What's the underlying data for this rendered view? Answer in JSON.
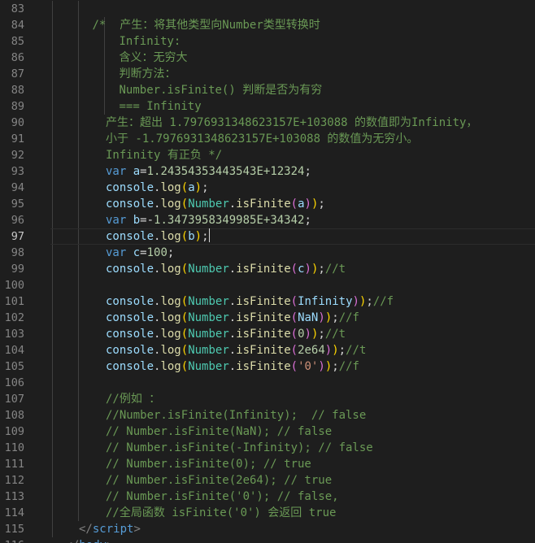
{
  "editor": {
    "current_line": "97",
    "lines": [
      {
        "n": "83",
        "indent": 0,
        "tokens": []
      },
      {
        "n": "84",
        "indent": 3,
        "tokens": [
          {
            "t": "/*  产生：将其他类型向Number类型转换时",
            "c": "comment"
          }
        ]
      },
      {
        "n": "85",
        "indent": 5,
        "tokens": [
          {
            "t": "Infinity:",
            "c": "comment"
          }
        ]
      },
      {
        "n": "86",
        "indent": 5,
        "tokens": [
          {
            "t": "含义：无穷大",
            "c": "comment"
          }
        ]
      },
      {
        "n": "87",
        "indent": 5,
        "tokens": [
          {
            "t": "判断方法：",
            "c": "comment"
          }
        ]
      },
      {
        "n": "88",
        "indent": 5,
        "tokens": [
          {
            "t": "Number.isFinite() 判断是否为有穷",
            "c": "comment"
          }
        ]
      },
      {
        "n": "89",
        "indent": 5,
        "tokens": [
          {
            "t": "=== Infinity",
            "c": "comment"
          }
        ]
      },
      {
        "n": "90",
        "indent": 4,
        "tokens": [
          {
            "t": "产生：超出 1.7976931348623157E+103088 的数值即为Infinity，",
            "c": "comment"
          }
        ]
      },
      {
        "n": "91",
        "indent": 4,
        "tokens": [
          {
            "t": "小于 -1.7976931348623157E+103088 的数值为无穷小。",
            "c": "comment"
          }
        ]
      },
      {
        "n": "92",
        "indent": 4,
        "tokens": [
          {
            "t": "Infinity 有正负 */",
            "c": "comment"
          }
        ]
      },
      {
        "n": "93",
        "indent": 4,
        "tokens": [
          {
            "t": "var",
            "c": "kw"
          },
          {
            "t": " ",
            "c": "punct"
          },
          {
            "t": "a",
            "c": "var"
          },
          {
            "t": "=",
            "c": "punct"
          },
          {
            "t": "1.24354353443543E+12324",
            "c": "num"
          },
          {
            "t": ";",
            "c": "punct"
          }
        ]
      },
      {
        "n": "94",
        "indent": 4,
        "tokens": [
          {
            "t": "console",
            "c": "obj"
          },
          {
            "t": ".",
            "c": "punct"
          },
          {
            "t": "log",
            "c": "fn"
          },
          {
            "t": "(",
            "c": "b1"
          },
          {
            "t": "a",
            "c": "var"
          },
          {
            "t": ")",
            "c": "b1"
          },
          {
            "t": ";",
            "c": "punct"
          }
        ]
      },
      {
        "n": "95",
        "indent": 4,
        "tokens": [
          {
            "t": "console",
            "c": "obj"
          },
          {
            "t": ".",
            "c": "punct"
          },
          {
            "t": "log",
            "c": "fn"
          },
          {
            "t": "(",
            "c": "b1"
          },
          {
            "t": "Number",
            "c": "type"
          },
          {
            "t": ".",
            "c": "punct"
          },
          {
            "t": "isFinite",
            "c": "fn"
          },
          {
            "t": "(",
            "c": "b2"
          },
          {
            "t": "a",
            "c": "var"
          },
          {
            "t": ")",
            "c": "b2"
          },
          {
            "t": ")",
            "c": "b1"
          },
          {
            "t": ";",
            "c": "punct"
          }
        ]
      },
      {
        "n": "96",
        "indent": 4,
        "tokens": [
          {
            "t": "var",
            "c": "kw"
          },
          {
            "t": " ",
            "c": "punct"
          },
          {
            "t": "b",
            "c": "var"
          },
          {
            "t": "=-",
            "c": "punct"
          },
          {
            "t": "1.3473958349985E+34342",
            "c": "num"
          },
          {
            "t": ";",
            "c": "punct"
          }
        ]
      },
      {
        "n": "97",
        "indent": 4,
        "tokens": [
          {
            "t": "console",
            "c": "obj"
          },
          {
            "t": ".",
            "c": "punct"
          },
          {
            "t": "log",
            "c": "fn"
          },
          {
            "t": "(",
            "c": "b1"
          },
          {
            "t": "b",
            "c": "var"
          },
          {
            "t": ")",
            "c": "b1"
          },
          {
            "t": ";",
            "c": "punct"
          }
        ],
        "cursor": true
      },
      {
        "n": "98",
        "indent": 4,
        "tokens": [
          {
            "t": "var",
            "c": "kw"
          },
          {
            "t": " ",
            "c": "punct"
          },
          {
            "t": "c",
            "c": "var"
          },
          {
            "t": "=",
            "c": "punct"
          },
          {
            "t": "100",
            "c": "num"
          },
          {
            "t": ";",
            "c": "punct"
          }
        ]
      },
      {
        "n": "99",
        "indent": 4,
        "tokens": [
          {
            "t": "console",
            "c": "obj"
          },
          {
            "t": ".",
            "c": "punct"
          },
          {
            "t": "log",
            "c": "fn"
          },
          {
            "t": "(",
            "c": "b1"
          },
          {
            "t": "Number",
            "c": "type"
          },
          {
            "t": ".",
            "c": "punct"
          },
          {
            "t": "isFinite",
            "c": "fn"
          },
          {
            "t": "(",
            "c": "b2"
          },
          {
            "t": "c",
            "c": "var"
          },
          {
            "t": ")",
            "c": "b2"
          },
          {
            "t": ")",
            "c": "b1"
          },
          {
            "t": ";",
            "c": "punct"
          },
          {
            "t": "//t",
            "c": "comment"
          }
        ]
      },
      {
        "n": "100",
        "indent": 4,
        "tokens": []
      },
      {
        "n": "101",
        "indent": 4,
        "tokens": [
          {
            "t": "console",
            "c": "obj"
          },
          {
            "t": ".",
            "c": "punct"
          },
          {
            "t": "log",
            "c": "fn"
          },
          {
            "t": "(",
            "c": "b1"
          },
          {
            "t": "Number",
            "c": "type"
          },
          {
            "t": ".",
            "c": "punct"
          },
          {
            "t": "isFinite",
            "c": "fn"
          },
          {
            "t": "(",
            "c": "b2"
          },
          {
            "t": "Infinity",
            "c": "const"
          },
          {
            "t": ")",
            "c": "b2"
          },
          {
            "t": ")",
            "c": "b1"
          },
          {
            "t": ";",
            "c": "punct"
          },
          {
            "t": "//f",
            "c": "comment"
          }
        ]
      },
      {
        "n": "102",
        "indent": 4,
        "tokens": [
          {
            "t": "console",
            "c": "obj"
          },
          {
            "t": ".",
            "c": "punct"
          },
          {
            "t": "log",
            "c": "fn"
          },
          {
            "t": "(",
            "c": "b1"
          },
          {
            "t": "Number",
            "c": "type"
          },
          {
            "t": ".",
            "c": "punct"
          },
          {
            "t": "isFinite",
            "c": "fn"
          },
          {
            "t": "(",
            "c": "b2"
          },
          {
            "t": "NaN",
            "c": "const"
          },
          {
            "t": ")",
            "c": "b2"
          },
          {
            "t": ")",
            "c": "b1"
          },
          {
            "t": ";",
            "c": "punct"
          },
          {
            "t": "//f",
            "c": "comment"
          }
        ]
      },
      {
        "n": "103",
        "indent": 4,
        "tokens": [
          {
            "t": "console",
            "c": "obj"
          },
          {
            "t": ".",
            "c": "punct"
          },
          {
            "t": "log",
            "c": "fn"
          },
          {
            "t": "(",
            "c": "b1"
          },
          {
            "t": "Number",
            "c": "type"
          },
          {
            "t": ".",
            "c": "punct"
          },
          {
            "t": "isFinite",
            "c": "fn"
          },
          {
            "t": "(",
            "c": "b2"
          },
          {
            "t": "0",
            "c": "num"
          },
          {
            "t": ")",
            "c": "b2"
          },
          {
            "t": ")",
            "c": "b1"
          },
          {
            "t": ";",
            "c": "punct"
          },
          {
            "t": "//t",
            "c": "comment"
          }
        ]
      },
      {
        "n": "104",
        "indent": 4,
        "tokens": [
          {
            "t": "console",
            "c": "obj"
          },
          {
            "t": ".",
            "c": "punct"
          },
          {
            "t": "log",
            "c": "fn"
          },
          {
            "t": "(",
            "c": "b1"
          },
          {
            "t": "Number",
            "c": "type"
          },
          {
            "t": ".",
            "c": "punct"
          },
          {
            "t": "isFinite",
            "c": "fn"
          },
          {
            "t": "(",
            "c": "b2"
          },
          {
            "t": "2e64",
            "c": "num"
          },
          {
            "t": ")",
            "c": "b2"
          },
          {
            "t": ")",
            "c": "b1"
          },
          {
            "t": ";",
            "c": "punct"
          },
          {
            "t": "//t",
            "c": "comment"
          }
        ]
      },
      {
        "n": "105",
        "indent": 4,
        "tokens": [
          {
            "t": "console",
            "c": "obj"
          },
          {
            "t": ".",
            "c": "punct"
          },
          {
            "t": "log",
            "c": "fn"
          },
          {
            "t": "(",
            "c": "b1"
          },
          {
            "t": "Number",
            "c": "type"
          },
          {
            "t": ".",
            "c": "punct"
          },
          {
            "t": "isFinite",
            "c": "fn"
          },
          {
            "t": "(",
            "c": "b2"
          },
          {
            "t": "'0'",
            "c": "str"
          },
          {
            "t": ")",
            "c": "b2"
          },
          {
            "t": ")",
            "c": "b1"
          },
          {
            "t": ";",
            "c": "punct"
          },
          {
            "t": "//f",
            "c": "comment"
          }
        ]
      },
      {
        "n": "106",
        "indent": 4,
        "tokens": []
      },
      {
        "n": "107",
        "indent": 4,
        "tokens": [
          {
            "t": "//例如 ：",
            "c": "comment"
          }
        ]
      },
      {
        "n": "108",
        "indent": 4,
        "tokens": [
          {
            "t": "//Number.isFinite(Infinity);  // false",
            "c": "comment"
          }
        ]
      },
      {
        "n": "109",
        "indent": 4,
        "tokens": [
          {
            "t": "// Number.isFinite(NaN); // false",
            "c": "comment"
          }
        ]
      },
      {
        "n": "110",
        "indent": 4,
        "tokens": [
          {
            "t": "// Number.isFinite(-Infinity); // false",
            "c": "comment"
          }
        ]
      },
      {
        "n": "111",
        "indent": 4,
        "tokens": [
          {
            "t": "// Number.isFinite(0); // true",
            "c": "comment"
          }
        ]
      },
      {
        "n": "112",
        "indent": 4,
        "tokens": [
          {
            "t": "// Number.isFinite(2e64); // true",
            "c": "comment"
          }
        ]
      },
      {
        "n": "113",
        "indent": 4,
        "tokens": [
          {
            "t": "// Number.isFinite('0'); // false,",
            "c": "comment"
          }
        ]
      },
      {
        "n": "114",
        "indent": 4,
        "tokens": [
          {
            "t": "//全局函数 isFinite('0') 会返回 true",
            "c": "comment"
          }
        ]
      },
      {
        "n": "115",
        "indent": 2,
        "tokens": [
          {
            "t": "</",
            "c": "tagp"
          },
          {
            "t": "script",
            "c": "tag"
          },
          {
            "t": ">",
            "c": "tagp"
          }
        ]
      },
      {
        "n": "116",
        "indent": 1,
        "tokens": [
          {
            "t": "</",
            "c": "tagp"
          },
          {
            "t": "body",
            "c": "tag"
          },
          {
            "t": ">",
            "c": "tagp"
          }
        ]
      }
    ]
  },
  "colors": {
    "background": "#1e1e1e",
    "line_number": "#858585",
    "comment": "#6a9955",
    "keyword": "#569cd6",
    "function": "#dcdcaa",
    "type": "#4ec9b0",
    "number": "#b5cea8",
    "string": "#ce9178"
  }
}
